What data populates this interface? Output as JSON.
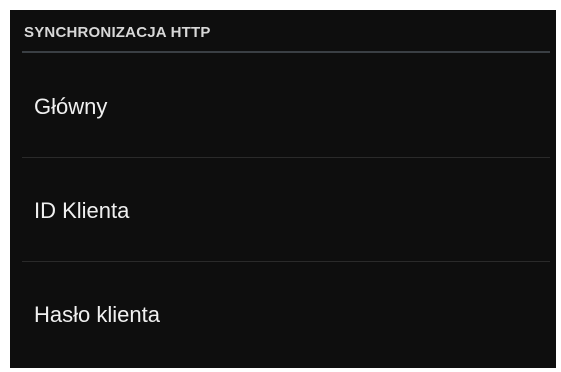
{
  "section": {
    "title": "SYNCHRONIZACJA HTTP"
  },
  "items": [
    {
      "label": "Główny"
    },
    {
      "label": "ID Klienta"
    },
    {
      "label": "Hasło klienta"
    }
  ],
  "colors": {
    "background": "#0e0e0e",
    "header_text": "#d8d8d8",
    "item_text": "#f0f0f0",
    "header_divider": "#3a3f44",
    "item_divider": "#2a2a2a"
  }
}
